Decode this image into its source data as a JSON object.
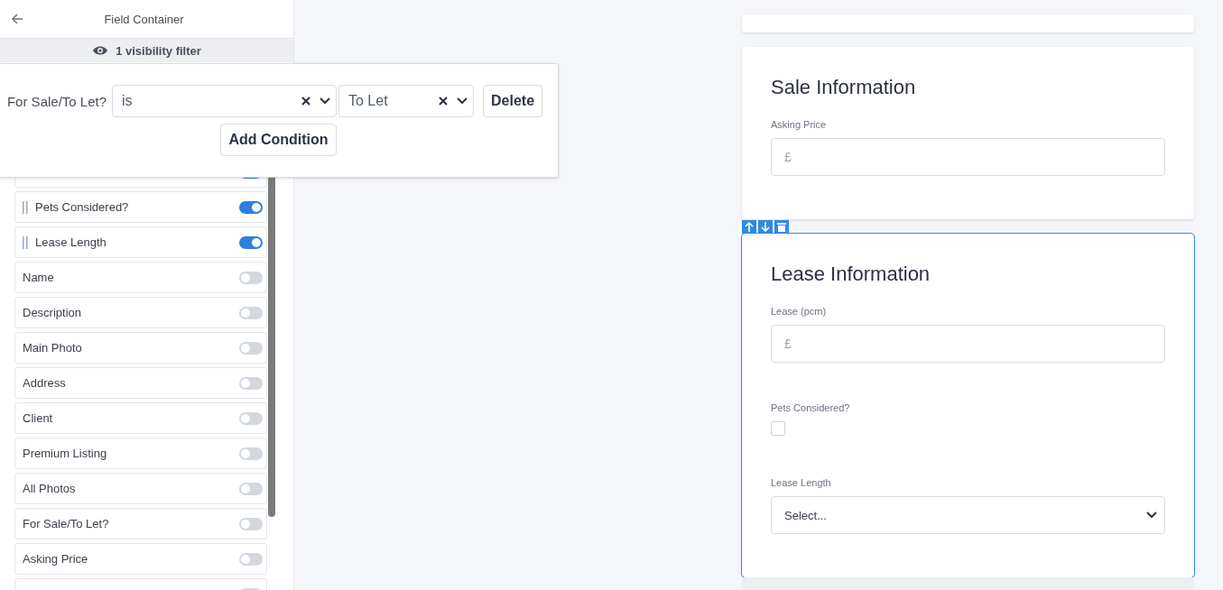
{
  "panel": {
    "title": "Field Container",
    "filter_summary": "1 visibility filter"
  },
  "filter_popover": {
    "field": "For Sale/To Let?",
    "operator": "is",
    "value": "To Let",
    "delete": "Delete",
    "add": "Add Condition"
  },
  "fields": [
    {
      "on": true
    },
    {
      "label": "Pets Considered?",
      "on": true
    },
    {
      "label": "Lease Length",
      "on": true
    },
    {
      "label": "Name",
      "on": false
    },
    {
      "label": "Description",
      "on": false
    },
    {
      "label": "Main Photo",
      "on": false
    },
    {
      "label": "Address",
      "on": false
    },
    {
      "label": "Client",
      "on": false
    },
    {
      "label": "Premium Listing",
      "on": false
    },
    {
      "label": "All Photos",
      "on": false
    },
    {
      "label": "For Sale/To Let?",
      "on": false
    },
    {
      "label": "Asking Price",
      "on": false
    },
    {
      "on": false
    }
  ],
  "cards": [
    {
      "selected": false
    },
    {
      "title": "Sale Information",
      "selected": false,
      "fields": [
        {
          "kind": "money",
          "label": "Asking Price",
          "prefix": "£"
        }
      ]
    },
    {
      "title": "Lease Information",
      "selected": true,
      "fields": [
        {
          "kind": "money",
          "label": "Lease (pcm)",
          "prefix": "£"
        },
        {
          "kind": "checkbox",
          "label": "Pets Considered?",
          "checked": false
        },
        {
          "kind": "select",
          "label": "Lease Length",
          "placeholder": "Select..."
        }
      ]
    }
  ]
}
